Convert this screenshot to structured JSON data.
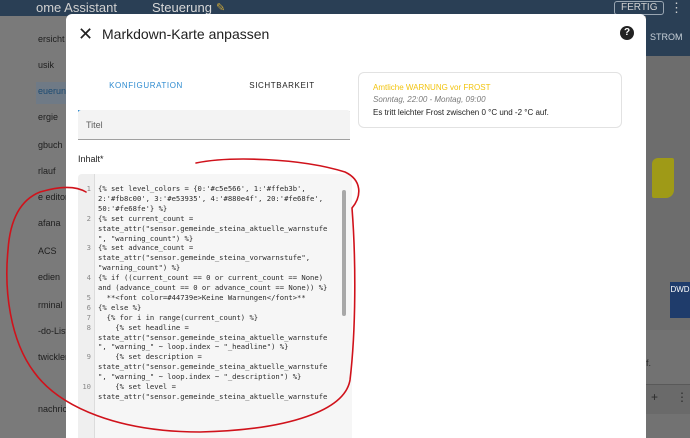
{
  "app": {
    "title": "ome Assistant",
    "view_name": "Steuerung",
    "done_button": "FERTIG",
    "menu_dots": "⋮",
    "pencil_icon": "pencil-icon",
    "strom_tab": "STROM",
    "dwd_logo": "DWD",
    "bottom_text": "f.",
    "plus_glyph": "+",
    "more_glyph": "⋮"
  },
  "sidebar": {
    "items": [
      {
        "label": "ersicht",
        "active": false
      },
      {
        "label": "usik",
        "active": false
      },
      {
        "label": "euerung",
        "active": true
      },
      {
        "label": "ergie",
        "active": false
      },
      {
        "label": "gbuch",
        "active": false
      },
      {
        "label": "rlauf",
        "active": false
      },
      {
        "label": "e editor",
        "active": false
      },
      {
        "label": "afana",
        "active": false
      },
      {
        "label": "ACS",
        "active": false
      },
      {
        "label": "edien",
        "active": false
      },
      {
        "label": "rminal",
        "active": false
      },
      {
        "label": "-do-List",
        "active": false
      },
      {
        "label": "twickler",
        "active": false
      },
      {
        "label": "nachrich",
        "active": false
      }
    ]
  },
  "dialog": {
    "title": "Markdown-Karte anpassen",
    "close_glyph": "✕",
    "help_glyph": "?",
    "tabs": [
      {
        "label": "KONFIGURATION",
        "active": true
      },
      {
        "label": "SICHTBARKEIT",
        "active": false
      }
    ],
    "title_field_label": "Titel",
    "content_label": "Inhalt*",
    "code_lines": [
      {
        "num": "1",
        "text": "{% set level_colors = {0:'#c5e566', 1:'#ffeb3b',"
      },
      {
        "num": "",
        "text": "2:'#fb8c00', 3:'#e53935', 4:'#880e4f', 20:'#fe68fe',"
      },
      {
        "num": "",
        "text": "50:'#fe68fe'} %}"
      },
      {
        "num": "2",
        "text": "{% set current_count ="
      },
      {
        "num": "",
        "text": "state_attr(\"sensor.gemeinde_steina_aktuelle_warnstufe"
      },
      {
        "num": "",
        "text": "\", \"warning_count\") %}"
      },
      {
        "num": "3",
        "text": "{% set advance_count ="
      },
      {
        "num": "",
        "text": "state_attr(\"sensor.gemeinde_steina_vorwarnstufe\","
      },
      {
        "num": "",
        "text": "\"warning_count\") %}"
      },
      {
        "num": "4",
        "text": "{% if ((current_count == 0 or current_count == None)"
      },
      {
        "num": "",
        "text": "and (advance_count == 0 or advance_count == None)) %}"
      },
      {
        "num": "5",
        "text": "  **<font color=#44739e>Keine Warnungen</font>**"
      },
      {
        "num": "6",
        "text": "{% else %}"
      },
      {
        "num": "7",
        "text": "  {% for i in range(current_count) %}"
      },
      {
        "num": "8",
        "text": "    {% set headline ="
      },
      {
        "num": "",
        "text": "state_attr(\"sensor.gemeinde_steina_aktuelle_warnstufe"
      },
      {
        "num": "",
        "text": "\", \"warning_\" ~ loop.index ~ \"_headline\") %}"
      },
      {
        "num": "9",
        "text": "    {% set description ="
      },
      {
        "num": "",
        "text": "state_attr(\"sensor.gemeinde_steina_aktuelle_warnstufe"
      },
      {
        "num": "",
        "text": "\", \"warning_\" ~ loop.index ~ \"_description\") %}"
      },
      {
        "num": "10",
        "text": "    {% set level ="
      },
      {
        "num": "",
        "text": "state_attr(\"sensor.gemeinde_steina_aktuelle_warnstufe"
      }
    ]
  },
  "preview": {
    "headline": "Amtliche WARNUNG vor FROST",
    "time": "Sonntag, 22:00 - Montag, 09:00",
    "description": "Es tritt leichter Frost zwischen 0 °C und -2 °C auf.",
    "headline_color": "#f2c40f"
  },
  "colors": {
    "accent": "#2e8bd0",
    "annotation": "#d0121b"
  }
}
